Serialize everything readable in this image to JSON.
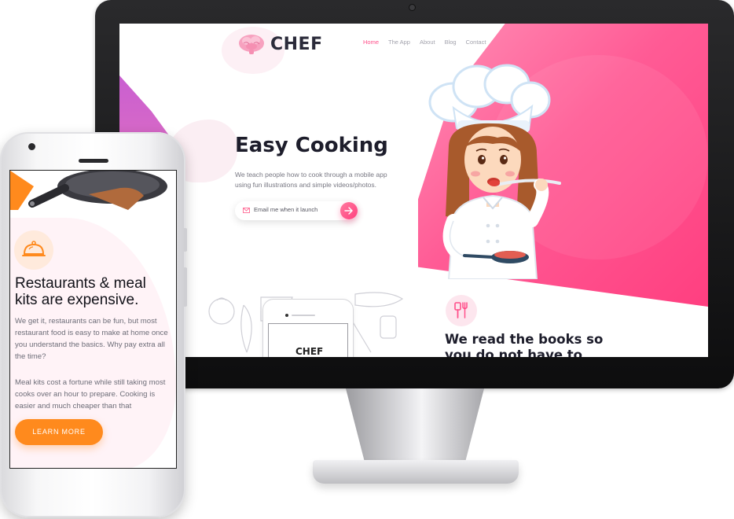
{
  "desktop": {
    "brand": "CHEF",
    "nav": [
      "Home",
      "The App",
      "About",
      "Blog",
      "Contact"
    ],
    "hero": {
      "title": "Easy Cooking",
      "subtitle": "We teach people how to cook through a mobile app using fun illustrations and simple videos/photos.",
      "email_placeholder": "Email me when it launch"
    },
    "mini_phone_brand": "CHEF",
    "feature_title": "We read the books so you do not have to"
  },
  "mobile": {
    "title": "Restaurants & meal kits are expensive.",
    "paragraph_1": "We get it, restaurants can be fun, but most restaurant food is easy to make at home once you understand the basics. Why pay extra all the time?",
    "paragraph_2": "Meal kits cost a fortune while still taking most cooks over an hour to prepare. Cooking is easier and much cheaper than that",
    "cta": "LEARN MORE"
  },
  "colors": {
    "accent_pink": "#ff4f8a",
    "accent_orange": "#ff8a1d",
    "heading_dark": "#1d1d2b"
  },
  "icons": [
    "brain-icon",
    "mail-icon",
    "arrow-right-icon",
    "kitchen-tools-icon",
    "cloche-icon"
  ]
}
